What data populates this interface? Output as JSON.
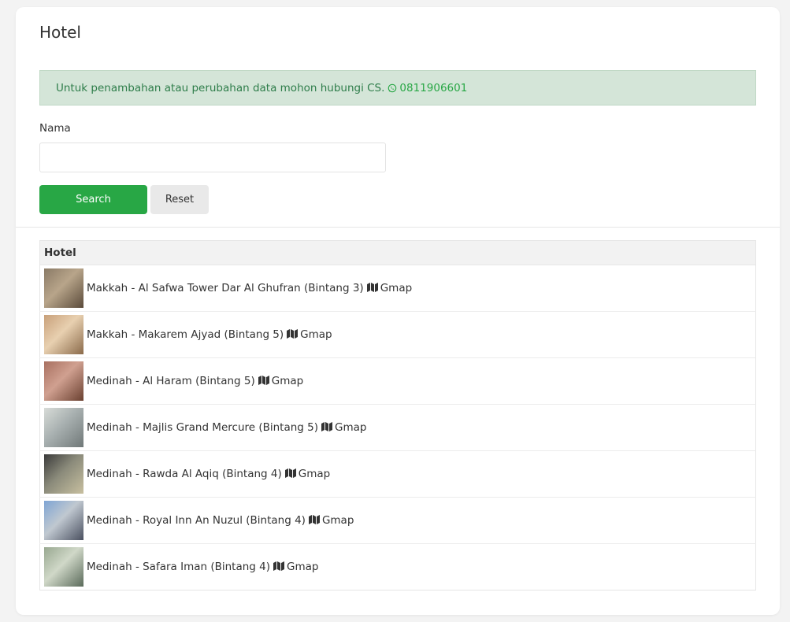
{
  "page": {
    "title": "Hotel"
  },
  "alert": {
    "text": "Untuk penambahan atau perubahan data mohon hubungi CS.",
    "phone": "0811906601"
  },
  "form": {
    "name_label": "Nama",
    "name_value": "",
    "name_placeholder": "",
    "search_label": "Search",
    "reset_label": "Reset"
  },
  "table": {
    "header": "Hotel",
    "gmap_label": "Gmap",
    "rows": [
      {
        "label": "Makkah - Al Safwa Tower Dar Al Ghufran (Bintang 3)"
      },
      {
        "label": "Makkah - Makarem Ajyad (Bintang 5)"
      },
      {
        "label": "Medinah - Al Haram (Bintang 5)"
      },
      {
        "label": "Medinah - Majlis Grand Mercure (Bintang 5)"
      },
      {
        "label": "Medinah - Rawda Al Aqiq (Bintang 4)"
      },
      {
        "label": "Medinah - Royal Inn An Nuzul (Bintang 4)"
      },
      {
        "label": "Medinah - Safara Iman (Bintang 4)"
      }
    ]
  },
  "colors": {
    "accent": "#28a745",
    "alert_bg": "#d4e5d8",
    "alert_text": "#2e7d4a"
  },
  "icons": {
    "phone": "whatsapp-icon",
    "map": "map-icon"
  }
}
